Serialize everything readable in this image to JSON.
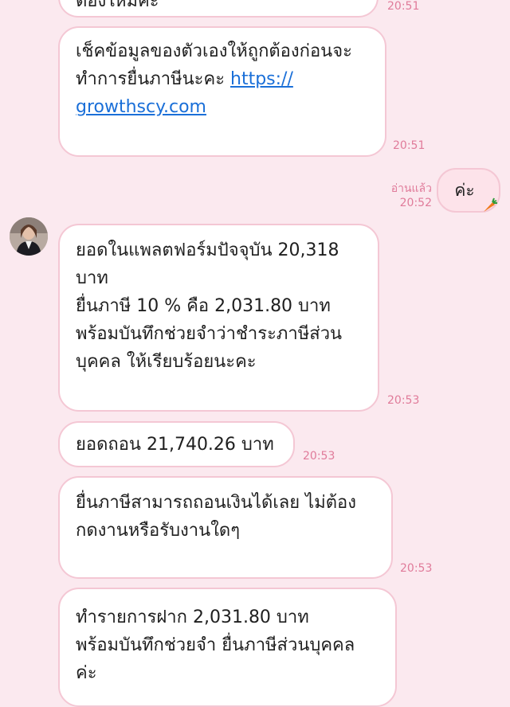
{
  "messages": {
    "m0": {
      "lines": [
        "ต้องใหม่ค่ะ"
      ],
      "time": "20:51"
    },
    "m1": {
      "lines": [
        "เช็คข้อมูลของตัวเองให้ถูกต้องก่อนจะ",
        "ทำการยื่นภาษีนะคะ "
      ],
      "link_part1": "https://",
      "link_part2": "growthscy.com",
      "time": "20:51"
    },
    "m2_out": {
      "text": "ค่ะ",
      "read_label": "อ่านแล้ว",
      "time": "20:52",
      "sticker": "carrot-icon"
    },
    "m3": {
      "lines": [
        "ยอดในแพลตฟอร์มปัจจุบัน 20,318",
        "บาท",
        "ยื่นภาษี 10 % คือ 2,031.80  บาท",
        "พร้อมบันทึกช่วยจำว่าชำระภาษีส่วน",
        "บุคคล  ให้เรียบร้อยนะคะ"
      ],
      "time": "20:53"
    },
    "m4": {
      "lines": [
        "ยอดถอน 21,740.26 บาท"
      ],
      "time": "20:53"
    },
    "m5": {
      "lines": [
        "ยื่นภาษีสามารถถอนเงินได้เลย ไม่ต้อง",
        "กดงานหรือรับงานใดๆ"
      ],
      "time": "20:53"
    },
    "m6": {
      "lines": [
        "ทำรายการฝาก 2,031.80 บาท",
        "พร้อมบันทึกช่วยจำ ยื่นภาษีส่วนบุคคล",
        "ค่ะ"
      ]
    }
  },
  "colors": {
    "background": "#fbe9ef",
    "bubble_border": "#f4c7d4",
    "time": "#e07b9a",
    "link": "#1a6fd8"
  }
}
